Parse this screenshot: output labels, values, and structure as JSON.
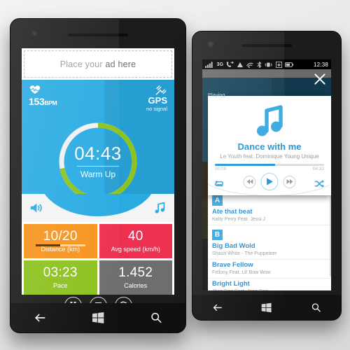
{
  "left_phone": {
    "ad_banner": {
      "text_prefix": "Place your ",
      "text_bold": "ad here"
    },
    "header": {
      "heart_icon": "heart-rate-icon",
      "bpm_value": "153",
      "bpm_unit": "BPM",
      "gps_icon": "gps-satellite-icon",
      "gps_label": "GPS",
      "gps_status": "no signal"
    },
    "timer": {
      "time": "04:43",
      "phase": "Warm Up",
      "progress_percent": 72
    },
    "media_row": {
      "volume_icon": "speaker-volume-icon",
      "music_icon": "music-note-icon"
    },
    "tiles": [
      {
        "value": "10/20",
        "label": "Distance (km)",
        "color": "#F7941E",
        "progress_percent": 50
      },
      {
        "value": "40",
        "label": "Avg speed (km/h)",
        "color": "#EE3050",
        "progress_percent": null
      },
      {
        "value": "03:23",
        "label": "Pace",
        "color": "#8DC21F",
        "progress_percent": null
      },
      {
        "value": "1.452",
        "label": "Calories",
        "color": "#6E6E6E",
        "progress_percent": null
      }
    ],
    "controls": [
      {
        "name": "pause-button",
        "icon": "pause-icon"
      },
      {
        "name": "stop-button",
        "icon": "stop-icon"
      },
      {
        "name": "restart-button",
        "icon": "refresh-icon"
      }
    ],
    "more_menu": "...",
    "navbar": [
      {
        "name": "back-button",
        "icon": "back-arrow-icon"
      },
      {
        "name": "start-button",
        "icon": "windows-logo-icon"
      },
      {
        "name": "search-button",
        "icon": "search-icon"
      }
    ]
  },
  "right_phone": {
    "status_bar": {
      "icons": [
        "signal-bars-icon",
        "call-forward-icon",
        "roaming-icon",
        "wifi-icon",
        "bluetooth-icon",
        "vibrate-icon",
        "airplane-mode-icon",
        "battery-icon"
      ],
      "network": "3G",
      "clock": "12:38"
    },
    "close_button": "close-icon",
    "playing_label": "Playing...",
    "player": {
      "album_icon": "music-note-icon",
      "title": "Dance with me",
      "artist": "Le Youth feat. Dominique Young Unique",
      "elapsed": "00:00",
      "duration": "04:32",
      "progress_percent": 55,
      "buttons": [
        {
          "name": "repeat-button",
          "icon": "repeat-icon"
        },
        {
          "name": "previous-button",
          "icon": "previous-track-icon"
        },
        {
          "name": "play-button",
          "icon": "play-icon"
        },
        {
          "name": "next-button",
          "icon": "next-track-icon"
        },
        {
          "name": "shuffle-button",
          "icon": "shuffle-icon"
        }
      ]
    },
    "playlist": [
      {
        "type": "group",
        "letter": "A"
      },
      {
        "type": "track",
        "title": "Ate that beat",
        "artist": "Katty Perry Feat. Jessi J"
      },
      {
        "type": "group",
        "letter": "B"
      },
      {
        "type": "track",
        "title": "Big Bad Wold",
        "artist": "Shaun White - The Puppeteer"
      },
      {
        "type": "track",
        "title": "Brave Fellow",
        "artist": "Fellony Feat. Lil' Bow Wow"
      },
      {
        "type": "track",
        "title": "Bright Light",
        "artist": "Jhon Doe Feat. Jane Doe"
      }
    ],
    "navbar": [
      {
        "name": "back-button",
        "icon": "back-arrow-icon"
      },
      {
        "name": "start-button",
        "icon": "windows-logo-icon"
      },
      {
        "name": "search-button",
        "icon": "search-icon"
      }
    ]
  },
  "colors": {
    "accent_blue": "#29ABE2",
    "ring_green": "#8DC21F",
    "orange": "#F7941E",
    "pink": "#EE3050",
    "green": "#8DC21F",
    "gray": "#6E6E6E"
  }
}
